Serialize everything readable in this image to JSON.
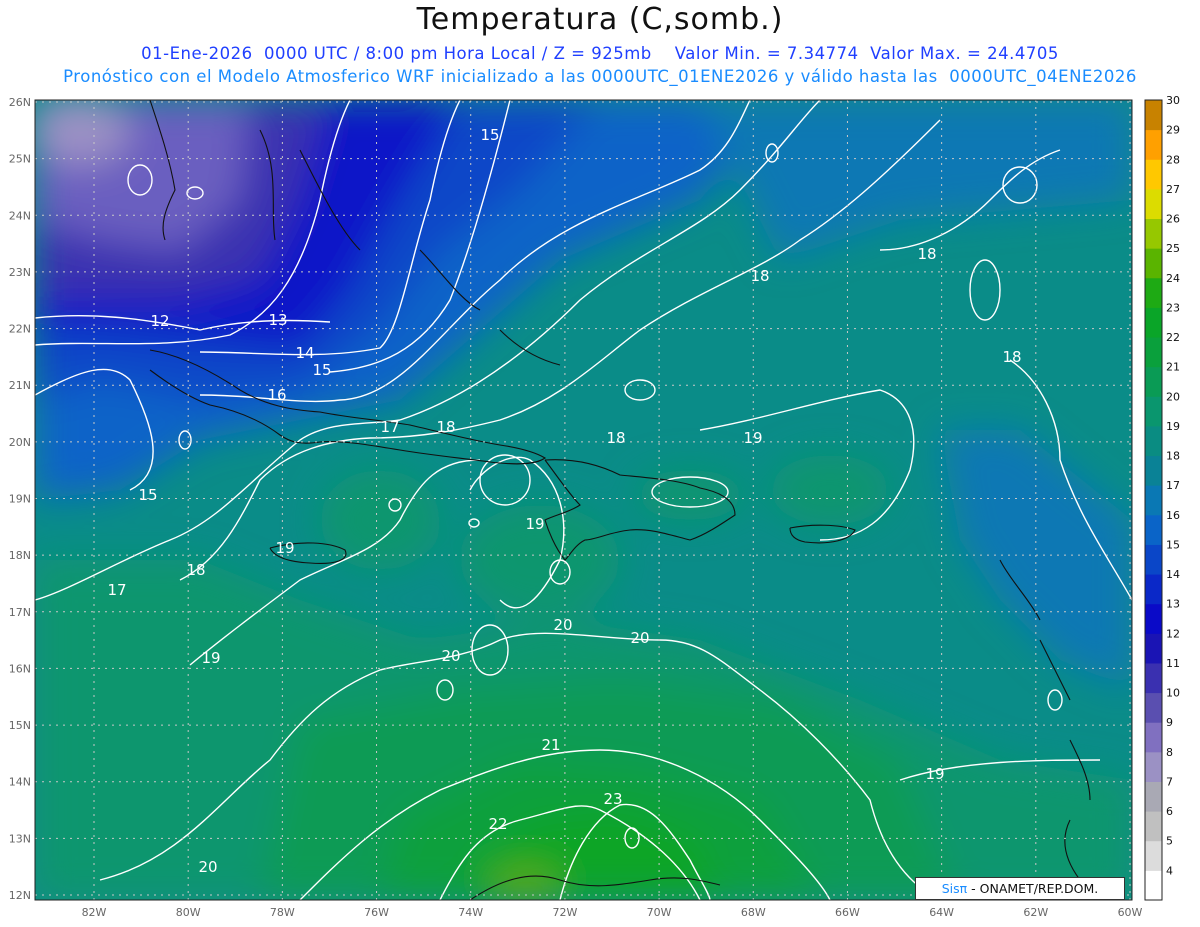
{
  "title": "Temperatura (C,somb.)",
  "subtitle_line1": "01-Ene-2026  0000 UTC / 8:00 pm Hora Local / Z = 925mb    Valor Min. = 7.34774  Valor Max. = 24.4705",
  "subtitle_line2": "Pronóstico con el Modelo Atmosferico WRF inicializado a las 0000UTC_01ENE2026 y válido hasta las  0000UTC_04ENE2026",
  "credit": {
    "brand": "Sisπ",
    "text": " - ONAMET/REP.DOM."
  },
  "lat_labels": [
    "12N",
    "13N",
    "14N",
    "15N",
    "16N",
    "17N",
    "18N",
    "19N",
    "20N",
    "21N",
    "22N",
    "23N",
    "24N",
    "25N",
    "26N"
  ],
  "lon_labels": [
    "82W",
    "80W",
    "78W",
    "76W",
    "74W",
    "72W",
    "70W",
    "68W",
    "66W",
    "64W",
    "62W",
    "60W"
  ],
  "colorbar_labels": [
    "4",
    "5",
    "6",
    "7",
    "8",
    "9",
    "10",
    "11",
    "12",
    "13",
    "14",
    "15",
    "16",
    "17",
    "18",
    "19",
    "20",
    "21",
    "22",
    "23",
    "24",
    "25",
    "26",
    "27",
    "28",
    "29",
    "30"
  ],
  "colorbar_colors": [
    "#ffffff",
    "#dcdcdc",
    "#c0c0c0",
    "#a9a9b4",
    "#9b91c4",
    "#8070c0",
    "#5a4fb0",
    "#3a30b0",
    "#1a14b4",
    "#0a0ac8",
    "#0a28c8",
    "#0a46c8",
    "#0a64c8",
    "#0a78b4",
    "#0a8296",
    "#0a8c82",
    "#0a966e",
    "#0a9b55",
    "#0aa03c",
    "#0aa528",
    "#1eaa14",
    "#5ab400",
    "#96c800",
    "#dcdc00",
    "#ffc800",
    "#ffa000",
    "#c88200"
  ],
  "contour_labels": [
    "12",
    "13",
    "14",
    "15",
    "15",
    "15",
    "16",
    "17",
    "17",
    "18",
    "18",
    "18",
    "18",
    "18",
    "18",
    "19",
    "19",
    "19",
    "19",
    "19",
    "20",
    "20",
    "20",
    "20",
    "21",
    "22",
    "23"
  ]
}
